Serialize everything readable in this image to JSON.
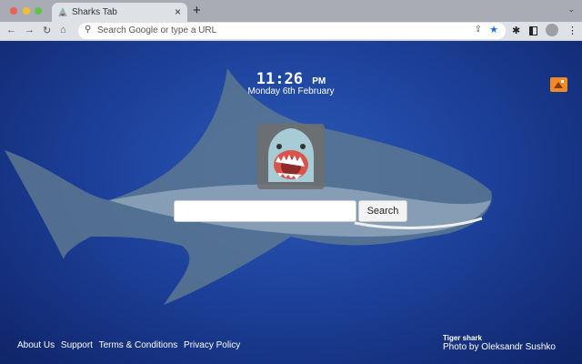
{
  "browser": {
    "tab_title": "Sharks Tab",
    "new_tab": "+",
    "tab_close": "×",
    "omnibox_placeholder": "Search Google or type a URL"
  },
  "clock": {
    "time": "11:26",
    "ampm": "PM",
    "date": "Monday 6th February"
  },
  "search": {
    "input_value": "",
    "button_label": "Search"
  },
  "footer": {
    "links": [
      "About Us",
      "Support",
      "Terms & Conditions",
      "Privacy Policy"
    ]
  },
  "credit": {
    "subject": "Tiger shark",
    "photographer": "Photo by Oleksandr Sushko"
  },
  "colors": {
    "accent": "#f08a24",
    "star": "#1a73e8"
  }
}
